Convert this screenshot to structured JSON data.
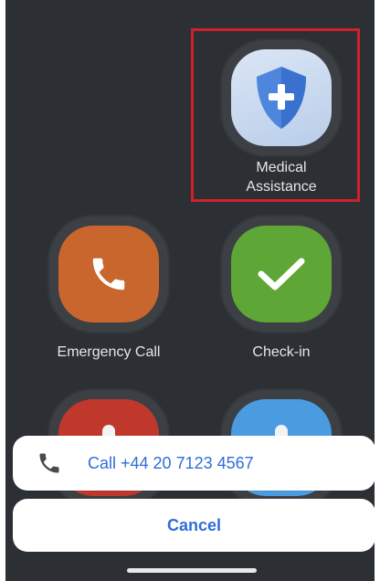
{
  "tiles": {
    "medical": {
      "label_line1": "Medical",
      "label_line2": "Assistance",
      "icon": "shield-plus-icon",
      "color": "#5b8fe0"
    },
    "emergency": {
      "label": "Emergency Call",
      "icon": "phone-icon",
      "color": "#c9662e"
    },
    "checkin": {
      "label": "Check-in",
      "icon": "checkmark-icon",
      "color": "#5ea736"
    },
    "partial_left": {
      "icon": "partial-icon",
      "color": "#c0372c"
    },
    "partial_right": {
      "icon": "partial-icon",
      "color": "#4a9be0"
    }
  },
  "action_sheet": {
    "call_label": "Call +44 20 7123 4567",
    "call_icon": "phone-icon",
    "cancel_label": "Cancel"
  },
  "colors": {
    "background": "#2c2f33",
    "accent": "#2f6ed8",
    "highlight": "#d0202a"
  }
}
